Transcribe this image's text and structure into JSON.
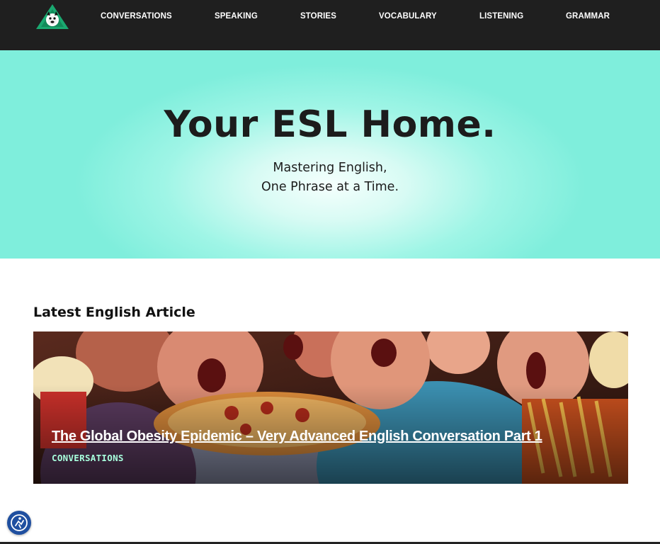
{
  "header": {
    "logo_icon": "mascot-logo-icon",
    "nav": [
      {
        "label": "CONVERSATIONS"
      },
      {
        "label": "SPEAKING"
      },
      {
        "label": "STORIES"
      },
      {
        "label": "VOCABULARY"
      },
      {
        "label": "LISTENING"
      },
      {
        "label": "GRAMMAR"
      }
    ]
  },
  "hero": {
    "title": "Your ESL Home.",
    "subtitle_line1": "Mastering English,",
    "subtitle_line2": "One Phrase at a Time."
  },
  "latest": {
    "section_title": "Latest English Article",
    "article": {
      "title": "The Global Obesity Epidemic – Very Advanced English Conversation Part 1",
      "category": "CONVERSATIONS"
    }
  },
  "accessibility": {
    "icon": "accessibility-icon",
    "color": "#1f4fa0"
  },
  "colors": {
    "header_bg": "#1f1f1f",
    "hero_accent": "#7feedc",
    "category_text": "#a8ffdd"
  }
}
